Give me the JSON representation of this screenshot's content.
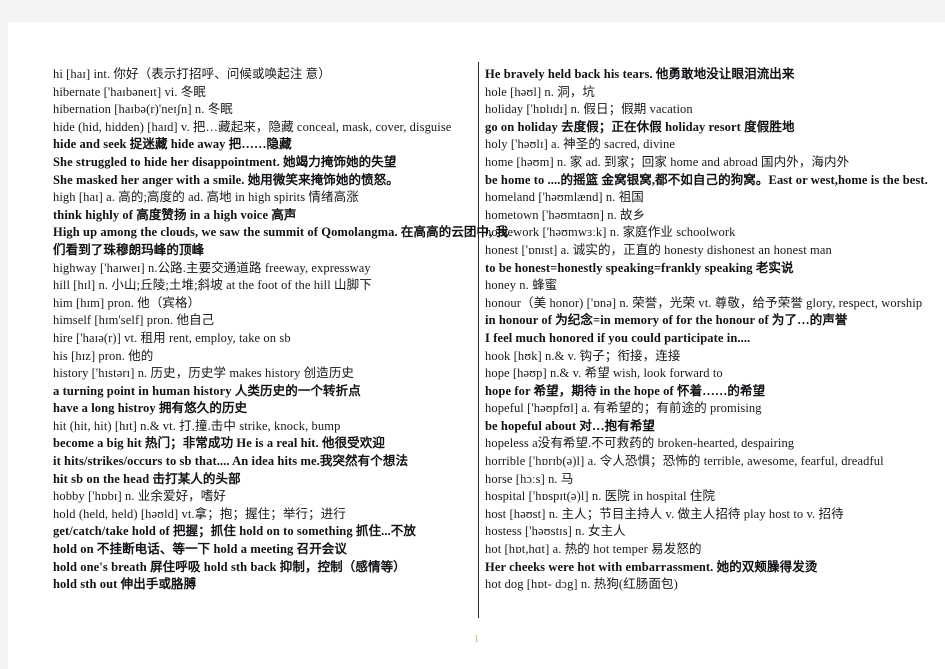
{
  "document": {
    "page_number": "1",
    "columns": [
      {
        "id": "left",
        "lines": [
          "hi [haɪ] int.  你好（表示打招呼、问候或唤起注 意）",
          "hibernate ['haɪbəneɪt] vi.  冬眠",
          "hibernation [haɪbə(r)'neɪʃn] n.  冬眠",
          "hide (hid, hidden) [haɪd] v. 把…藏起来，隐藏      conceal, mask, cover, disguise",
          "hide and seek  捉迷藏        hide away   把……隐藏",
          "She struggled to hide her disappointment.  她竭力掩饰她的失望",
          "She masked her anger with a smile.  她用微笑来掩饰她的愤怒。",
          "high [haɪ] a. 高的;高度的 ad. 高地     in high spirits  情绪高涨",
          "think highly of  高度赞扬       in a high voice  高声",
          "High up among the clouds, we saw the summit of Qomolangma.  在高高的云团中, 我",
          "们看到了珠穆朗玛峰的顶峰",
          "highway ['haɪweɪ] n.公路.主要交通道路     freeway, expressway",
          "hill [hɪl] n.  小山;丘陵;土堆;斜坡      at the foot of the hill 山脚下",
          "him [hɪm] pron.  他（宾格）",
          "himself [hɪm'self] pron.  他自己",
          "hire ['haɪə(r)] vt.  租用      rent, employ, take on sb",
          "his [hɪz] pron.  他的",
          "history ['hɪstərɪ] n.  历史，历史学          makes history 创造历史",
          "a turning point in human history   人类历史的一个转折点",
          "have a long histroy  拥有悠久的历史",
          "hit (hit, hit) [hɪt] n.& vt.  打.撞.击中       strike, knock, bump",
          "become a big hit   热门；非常成功       He is a real hit.  他很受欢迎",
          "it hits/strikes/occurs to sb that....          An idea hits me.我突然有个想法",
          "hit sb on the head   击打某人的头部",
          "hobby ['hɒbɪ] n.  业余爱好，嗜好",
          "hold (held, held) [həʊld] vt.拿；抱；握住；举行；进行",
          "get/catch/take hold of   把握；抓住        hold on to something   抓住...不放",
          "hold on   不挂断电话、等一下        hold a meeting  召开会议",
          "hold one's breath  屏住呼吸       hold sth back 抑制，控制（感情等）",
          "hold sth out   伸出手或胳膊"
        ]
      },
      {
        "id": "right",
        "lines": [
          "He bravely held back his tears.  他勇敢地没让眼泪流出来",
          "hole [həʊl] n.  洞，坑",
          "holiday ['hɒlɪdɪ] n.  假日；假期        vacation",
          "go on holiday   去度假；正在休假     holiday resort   度假胜地",
          "holy ['həʊlɪ] a.  神圣的    sacred, divine",
          "home [həʊm] n.  家  ad.  到家；回家        home and abroad   国内外，海内外",
          "be home to ....的摇篮      金窝银窝,都不如自己的狗窝。East or west,home is the best.",
          "homeland ['həʊmlænd] n.  祖国",
          "hometown ['həʊmtaʊn] n.  故乡",
          "homework ['həʊmwɜːk] n.  家庭作业      schoolwork",
          "honest ['ɒnɪst] a.  诚实的，正直的      honesty        dishonest       an honest man",
          "to be honest=honestly speaking=frankly speaking 老实说",
          "honey    n.  蜂蜜",
          "honour（美 honor) ['ɒnə] n.  荣誉，光荣  vt.  尊敬，给予荣誉  glory, respect, worship",
          "in honour of   为纪念=in memory of         for the honour of   为了…的声誉",
          "I feel much honored if you could participate in....",
          "hook [hʊk] n.& v.  钩子；衔接，连接",
          "hope [həʊp] n.& v.  希望      wish, look forward to",
          "hope for   希望，期待      in the hope of  怀着……的希望",
          "hopeful ['həʊpfʊl] a.  有希望的；有前途的         promising",
          "be hopeful about   对…抱有希望",
          "hopeless a没有希望.不可救药的      broken-hearted, despairing",
          "horrible ['hɒrɪb(ə)l] a.  令人恐惧；恐怖的   terrible, awesome, fearful, dreadful",
          "horse [hɔːs] n.  马",
          "hospital ['hɒspɪt(ə)l] n.  医院      in hospital   住院",
          "host [həʊst] n.  主人；节目主持人 v.  做主人招待     play host to   v.  招待",
          "hostess ['həʊstɪs] n.  女主人",
          "hot [hɒt,hɑt] a.  热的        hot temper   易发怒的",
          "Her cheeks were hot with embarrassment.  她的双颊臊得发烫",
          "hot dog [hɒt- dɔg] n.  热狗(红肠面包)"
        ]
      }
    ]
  }
}
